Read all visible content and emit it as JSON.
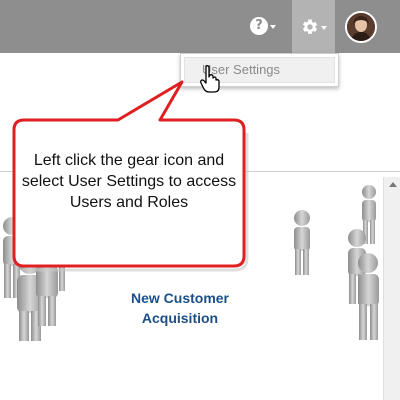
{
  "topbar": {
    "help_icon": "question-circle-icon",
    "help_glyph": "?",
    "settings_icon": "gear-icon",
    "avatar": "user-avatar"
  },
  "menu": {
    "user_settings_label": "User Settings"
  },
  "callout": {
    "text": "Left click the gear icon and select User Settings to access Users and Roles",
    "border_color": "#e02020"
  },
  "banner": {
    "title_line1": "New Customer",
    "title_line2": "Acquisition",
    "text_color": "#1c4f88"
  },
  "colors": {
    "topbar": "#8e8e8e",
    "gear_active": "#b3b3b3"
  }
}
